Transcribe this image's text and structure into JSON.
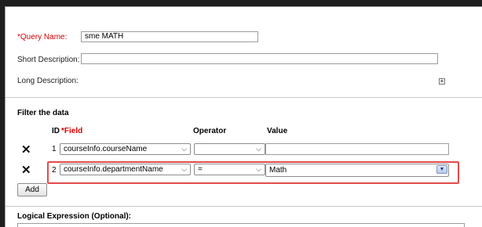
{
  "form": {
    "query_name_req_mark": "*",
    "query_name_label": "Query Name:",
    "query_name_value": "sme MATH",
    "short_desc_label": "Short Description:",
    "short_desc_value": "",
    "long_desc_label": "Long Description:",
    "long_desc_expand": "+"
  },
  "filter": {
    "section_title": "Filter the data",
    "col_id": "ID",
    "col_field_req_mark": "*",
    "col_field": "Field",
    "col_operator": "Operator",
    "col_value": "Value",
    "rows": [
      {
        "id": "1",
        "field": "courseInfo.courseName",
        "operator": "",
        "value": ""
      },
      {
        "id": "2",
        "field": "courseInfo.departmentName",
        "operator": "=",
        "value": "Math"
      }
    ],
    "add_label": "Add",
    "delete_glyph": "✕"
  },
  "logical": {
    "title": "Logical Expression (Optional):"
  },
  "icons": {
    "delete": "x-delete-icon",
    "dropdown": "chevron-down-icon",
    "expand": "plus-box-icon"
  },
  "colors": {
    "required": "#d40000",
    "highlight": "#e34b4b"
  }
}
